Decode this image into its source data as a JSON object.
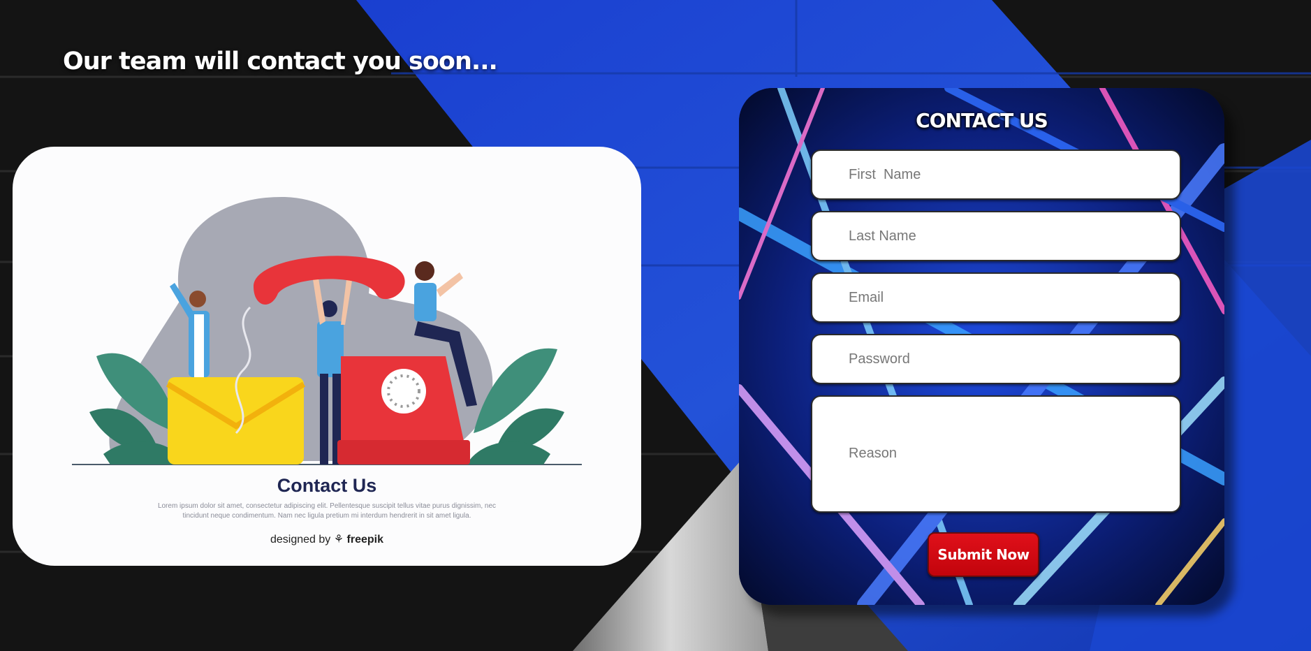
{
  "page": {
    "headline": "Our team will contact you soon..."
  },
  "illustration": {
    "title": "Contact Us",
    "lorem_line1": "Lorem ipsum dolor sit amet, consectetur adipiscing elit. Pellentesque suscipit tellus vitae purus dignissim, nec",
    "lorem_line2": "tincidunt neque condimentum. Nam nec ligula pretium mi interdum hendrerit in sit amet ligula.",
    "credit_prefix": "designed by",
    "credit_brand": "freepik"
  },
  "form": {
    "title": "CONTACT US",
    "first_name_placeholder": "First  Name",
    "last_name_placeholder": "Last Name",
    "email_placeholder": "Email",
    "password_placeholder": "Password",
    "reason_placeholder": "Reason",
    "submit_label": "Submit Now"
  },
  "colors": {
    "brand_blue": "#1f47c7",
    "submit_red": "#d10a12",
    "card_title": "#1f2653"
  }
}
